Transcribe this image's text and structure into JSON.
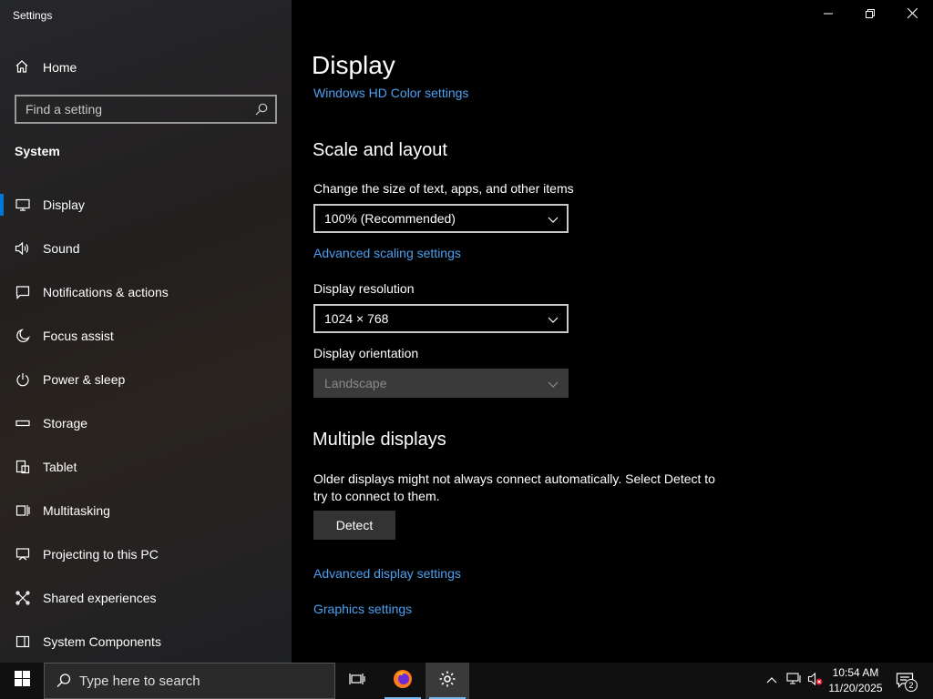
{
  "window": {
    "title": "Settings",
    "controls": {
      "minimize": "minimize-icon",
      "restore": "restore-icon",
      "close": "close-icon"
    }
  },
  "sidebar": {
    "home_label": "Home",
    "search_placeholder": "Find a setting",
    "section_title": "System",
    "items": [
      {
        "label": "Display",
        "icon": "monitor-icon",
        "active": true
      },
      {
        "label": "Sound",
        "icon": "speaker-icon"
      },
      {
        "label": "Notifications & actions",
        "icon": "notification-icon"
      },
      {
        "label": "Focus assist",
        "icon": "moon-icon"
      },
      {
        "label": "Power & sleep",
        "icon": "power-icon"
      },
      {
        "label": "Storage",
        "icon": "storage-icon"
      },
      {
        "label": "Tablet",
        "icon": "tablet-icon"
      },
      {
        "label": "Multitasking",
        "icon": "multitasking-icon"
      },
      {
        "label": "Projecting to this PC",
        "icon": "projecting-icon"
      },
      {
        "label": "Shared experiences",
        "icon": "shared-icon"
      },
      {
        "label": "System Components",
        "icon": "components-icon"
      }
    ]
  },
  "main": {
    "title": "Display",
    "hd_color_link": "Windows HD Color settings",
    "scale_section": "Scale and layout",
    "scale_label": "Change the size of text, apps, and other items",
    "scale_value": "100% (Recommended)",
    "advanced_scaling_link": "Advanced scaling settings",
    "resolution_label": "Display resolution",
    "resolution_value": "1024 × 768",
    "orientation_label": "Display orientation",
    "orientation_value": "Landscape",
    "multi_section": "Multiple displays",
    "multi_desc": "Older displays might not always connect automatically. Select Detect to try to connect to them.",
    "detect_button": "Detect",
    "advanced_display_link": "Advanced display settings",
    "graphics_link": "Graphics settings"
  },
  "taskbar": {
    "search_placeholder": "Type here to search",
    "time": "10:54 AM",
    "date": "11/20/2025",
    "notification_count": "2"
  },
  "colors": {
    "accent": "#0078d7",
    "link": "#4ca0f0"
  }
}
